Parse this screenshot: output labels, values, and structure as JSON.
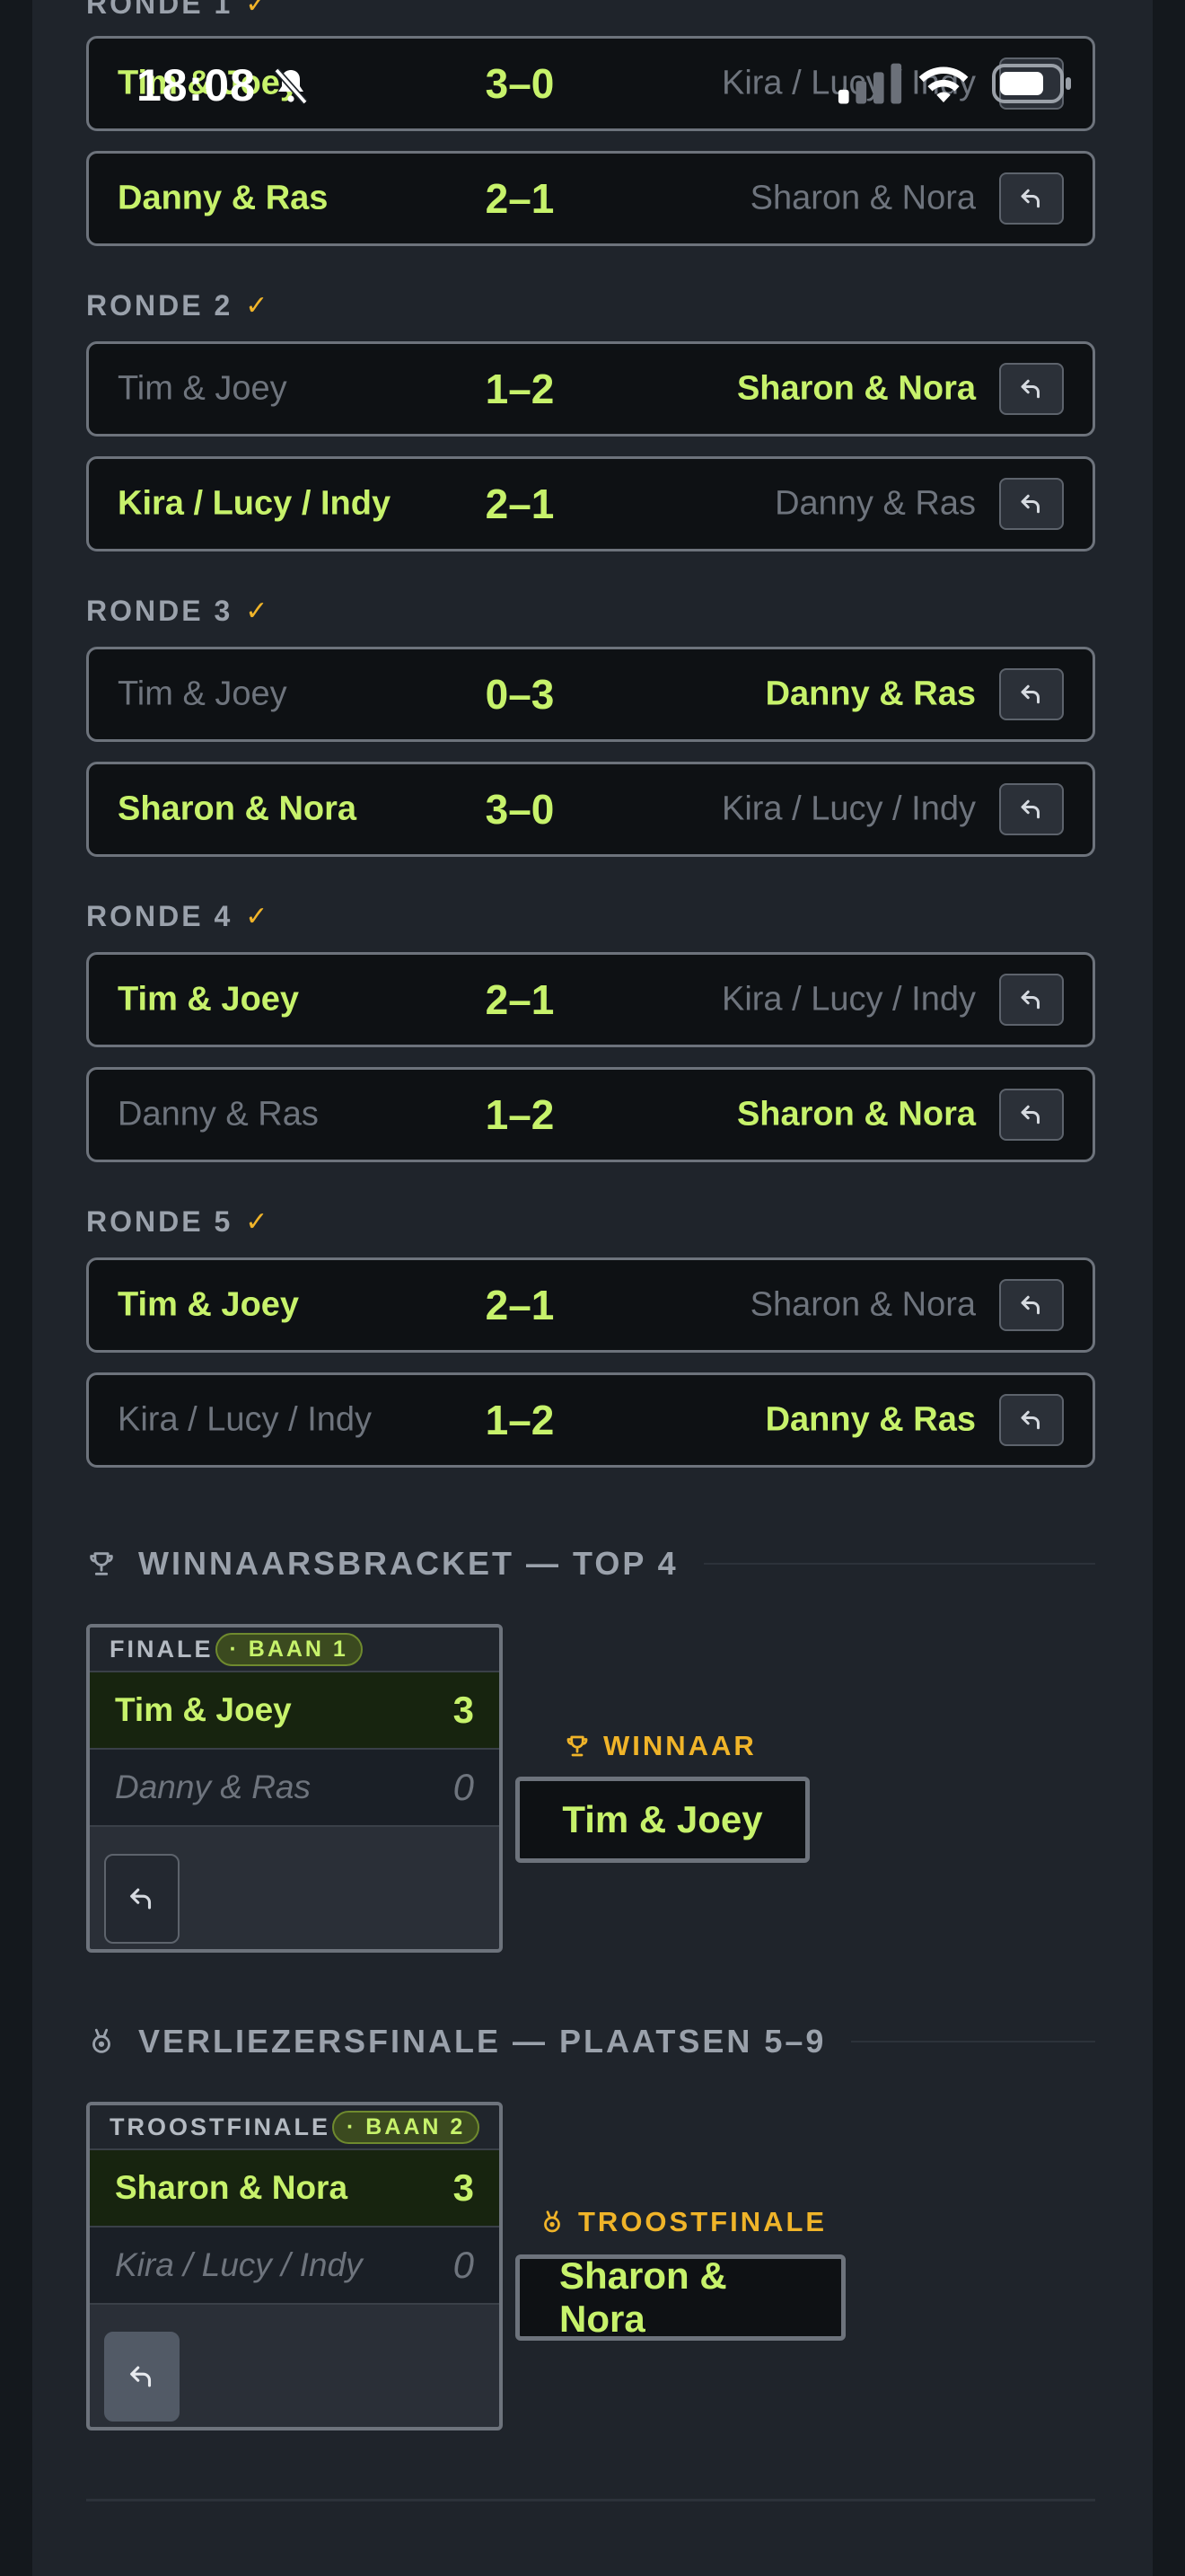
{
  "status_bar": {
    "time": "18:08"
  },
  "rounds": [
    {
      "label": "RONDE 1",
      "matches": [
        {
          "home": "Tim & Joey",
          "score": "3–0",
          "away": "Kira / Lucy / Indy",
          "winner": "home"
        },
        {
          "home": "Danny & Ras",
          "score": "2–1",
          "away": "Sharon & Nora",
          "winner": "home"
        }
      ]
    },
    {
      "label": "RONDE 2",
      "matches": [
        {
          "home": "Tim & Joey",
          "score": "1–2",
          "away": "Sharon & Nora",
          "winner": "away"
        },
        {
          "home": "Kira / Lucy / Indy",
          "score": "2–1",
          "away": "Danny & Ras",
          "winner": "home"
        }
      ]
    },
    {
      "label": "RONDE 3",
      "matches": [
        {
          "home": "Tim & Joey",
          "score": "0–3",
          "away": "Danny & Ras",
          "winner": "away"
        },
        {
          "home": "Sharon & Nora",
          "score": "3–0",
          "away": "Kira / Lucy / Indy",
          "winner": "home"
        }
      ]
    },
    {
      "label": "RONDE 4",
      "matches": [
        {
          "home": "Tim & Joey",
          "score": "2–1",
          "away": "Kira / Lucy / Indy",
          "winner": "home"
        },
        {
          "home": "Danny & Ras",
          "score": "1–2",
          "away": "Sharon & Nora",
          "winner": "away"
        }
      ]
    },
    {
      "label": "RONDE 5",
      "matches": [
        {
          "home": "Tim & Joey",
          "score": "2–1",
          "away": "Sharon & Nora",
          "winner": "home"
        },
        {
          "home": "Kira / Lucy / Indy",
          "score": "1–2",
          "away": "Danny & Ras",
          "winner": "away"
        }
      ]
    }
  ],
  "winners_bracket": {
    "title": "WINNAARSBRACKET — TOP 4",
    "card_label": "FINALE",
    "court": "· BAAN 1",
    "team_a": "Tim & Joey",
    "score_a": "3",
    "team_b": "Danny & Ras",
    "score_b": "0",
    "result_label": "WINNAAR",
    "result_team": "Tim & Joey"
  },
  "losers_final": {
    "title": "VERLIEZERSFINALE — PLAATSEN 5–9",
    "card_label": "TROOSTFINALE",
    "court": "· BAAN 2",
    "team_a": "Sharon & Nora",
    "score_a": "3",
    "team_b": "Kira / Lucy / Indy",
    "score_b": "0",
    "result_label": "TROOSTFINALE",
    "result_team": "Sharon & Nora"
  },
  "colors": {
    "accent": "#c7f26b",
    "gold": "#f0b429",
    "background": "#1f242b"
  }
}
